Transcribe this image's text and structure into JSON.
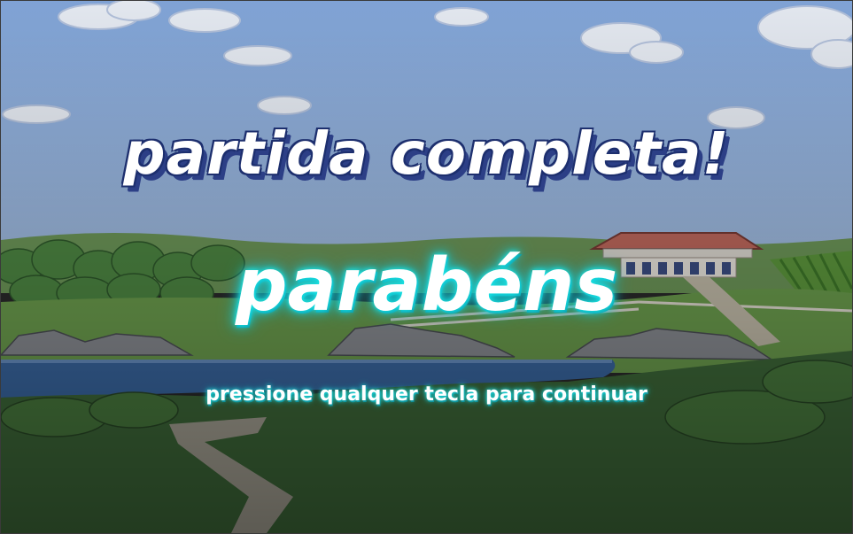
{
  "screen": {
    "title": "partida completa!",
    "congrats": "parabéns",
    "hint": "pressione qualquer tecla para continuar"
  },
  "colors": {
    "sky": "#7ca0d6",
    "title_shadow": "#2c3f86",
    "glow": "#19e6e6",
    "lake": "#3b6aa6",
    "grass": "#3f6b3a"
  }
}
